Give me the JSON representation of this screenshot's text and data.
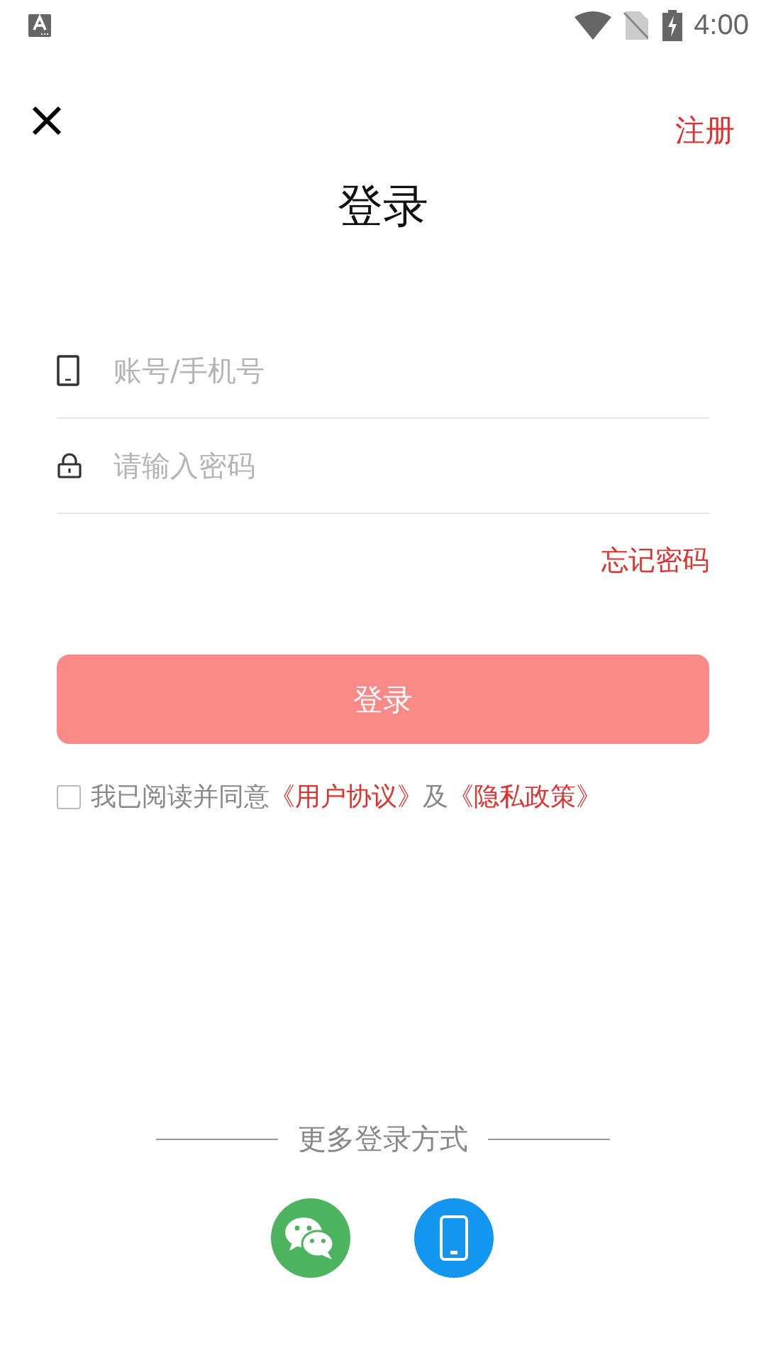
{
  "status_bar": {
    "time": "4:00"
  },
  "top_bar": {
    "register": "注册"
  },
  "title": "登录",
  "fields": [
    {
      "kind": "account",
      "placeholder": "账号/手机号"
    },
    {
      "kind": "password",
      "placeholder": "请输入密码"
    }
  ],
  "forgot_password": "忘记密码",
  "login_button": {
    "label": "登录",
    "disabled": true
  },
  "agreement": {
    "checked": false,
    "text_1": "我已阅读并同意",
    "link_1": "《用户协议》",
    "text_2": "及",
    "link_2": "《隐私政策》"
  },
  "more_login": {
    "label": "更多登录方式",
    "options": [
      {
        "kind": "wechat"
      },
      {
        "kind": "phone"
      }
    ]
  }
}
